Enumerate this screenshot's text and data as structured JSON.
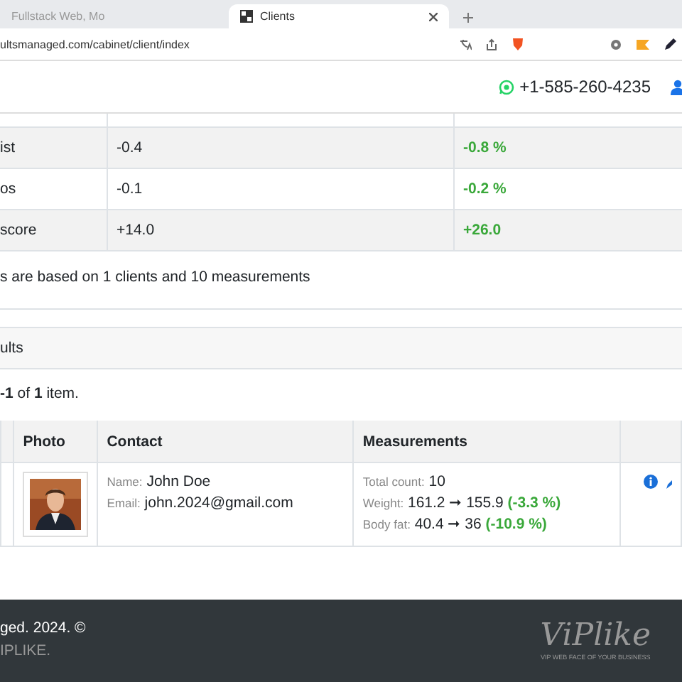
{
  "browser": {
    "tabs": [
      {
        "title": "Fullstack Web, Mo",
        "selected": false
      },
      {
        "title": "Clients",
        "selected": true
      }
    ],
    "url": "ultsmanaged.com/cabinet/client/index"
  },
  "header": {
    "phone": "+1-585-260-4235"
  },
  "stats": {
    "rows": [
      {
        "label": "ist",
        "value": "-0.4",
        "change": "-0.8 %"
      },
      {
        "label": "os",
        "value": "-0.1",
        "change": "-0.2 %"
      },
      {
        "label": "score",
        "value": "+14.0",
        "change": "+26.0"
      }
    ],
    "note": "s are based on 1 clients and 10 measurements"
  },
  "results": {
    "title": "ults",
    "summary": "**-1** of **1** item.",
    "columns": [
      "Photo",
      "Contact",
      "Measurements"
    ],
    "rows": [
      {
        "name_label": "Name:",
        "name": "John Doe",
        "email_label": "Email:",
        "email": "john.2024@gmail.com",
        "count_label": "Total count:",
        "count": "10",
        "weight_label": "Weight:",
        "weight": "161.2 ➞ 155.9",
        "weight_change": "(-3.3 %)",
        "fat_label": "Body fat:",
        "fat": "40.4 ➞ 36",
        "fat_change": "(-10.9 %)"
      }
    ]
  },
  "footer": {
    "copyright": "ged. 2024. ©",
    "made_by": "IPLIKE.",
    "logo": "ViPlike",
    "tagline": "VIP WEB FACE OF YOUR BUSINESS"
  }
}
